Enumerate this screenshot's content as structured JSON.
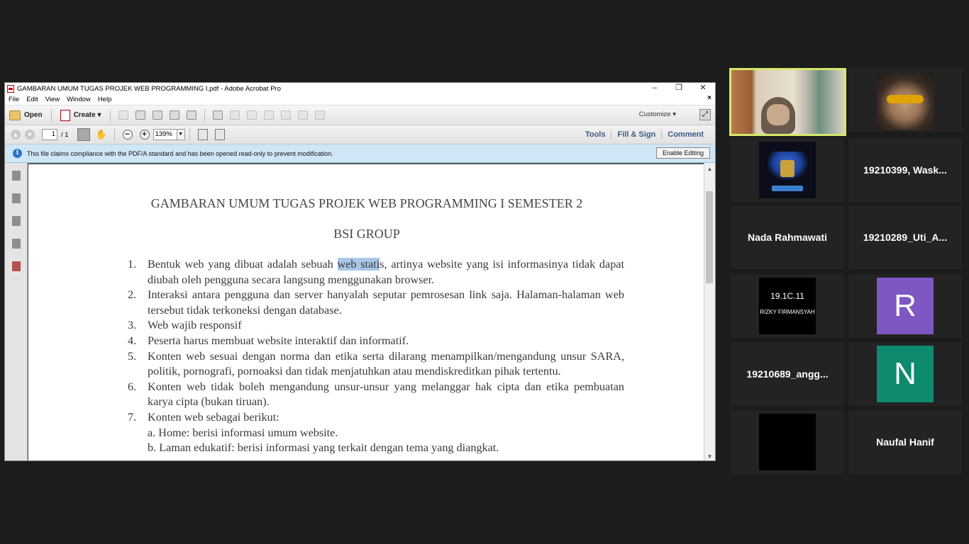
{
  "window": {
    "title": "GAMBARAN UMUM TUGAS PROJEK WEB PROGRAMMING I.pdf - Adobe Acrobat Pro",
    "minimize": "–",
    "restore": "❐",
    "close": "✕"
  },
  "menu": [
    "File",
    "Edit",
    "View",
    "Window",
    "Help"
  ],
  "menu_close": "×",
  "toolbar": {
    "open": "Open",
    "create": "Create ▾",
    "customize": "Customize ▾"
  },
  "nav": {
    "page_current": "1",
    "page_total": "/ 1",
    "zoom": "139%"
  },
  "tabs": [
    "Tools",
    "Fill & Sign",
    "Comment"
  ],
  "infobar": {
    "message": "This file claims compliance with the PDF/A standard and has been opened read-only to prevent modification.",
    "button": "Enable Editing"
  },
  "document": {
    "title": "GAMBARAN UMUM TUGAS PROJEK WEB PROGRAMMING I SEMESTER 2",
    "subtitle": "BSI GROUP",
    "items": [
      {
        "num": "1.",
        "pre": "Bentuk web yang dibuat adalah sebuah ",
        "highlight": "web stati",
        "post": "s, artinya website yang isi informasinya tidak dapat diubah oleh pengguna secara langsung menggunakan browser."
      },
      {
        "num": "2.",
        "text": "Interaksi antara pengguna dan server hanyalah seputar pemrosesan link saja. Halaman-halaman web tersebut tidak terkoneksi dengan database."
      },
      {
        "num": "3.",
        "text": "Web wajib responsif"
      },
      {
        "num": "4.",
        "text": "Peserta harus membuat website interaktif dan informatif."
      },
      {
        "num": "5.",
        "text": "Konten web sesuai dengan norma dan etika serta dilarang menampilkan/mengandung unsur SARA, politik, pornografi, pornoaksi dan tidak menjatuhkan atau mendiskreditkan pihak tertentu."
      },
      {
        "num": "6.",
        "text": "Konten web tidak boleh mengandung unsur-unsur yang melanggar hak cipta dan etika pembuatan karya cipta (bukan tiruan)."
      },
      {
        "num": "7.",
        "text": "Konten web sebagai berikut:"
      }
    ],
    "sub_items": [
      "a.  Home: berisi informasi umum website.",
      "b.  Laman edukatif: berisi informasi yang terkait dengan tema yang diangkat."
    ]
  },
  "participants": [
    {
      "name": "",
      "type": "video"
    },
    {
      "name": "",
      "type": "image-man"
    },
    {
      "name": "",
      "type": "image-logo"
    },
    {
      "name": "19210399, Wask...",
      "type": "name"
    },
    {
      "name": "Nada Rahmawati",
      "type": "name"
    },
    {
      "name": "19210289_Uti_A...",
      "type": "name"
    },
    {
      "name": "",
      "type": "image-text",
      "line1": "19.1C.11",
      "line2": "RIZKY FIRMANSYAH"
    },
    {
      "name": "",
      "type": "avatar",
      "letter": "R",
      "color": "#7e57c2"
    },
    {
      "name": "19210689_angg...",
      "type": "name"
    },
    {
      "name": "",
      "type": "avatar",
      "letter": "N",
      "color": "#0e8a6e"
    },
    {
      "name": "",
      "type": "black"
    },
    {
      "name": "Naufal Hanif",
      "type": "name"
    }
  ]
}
